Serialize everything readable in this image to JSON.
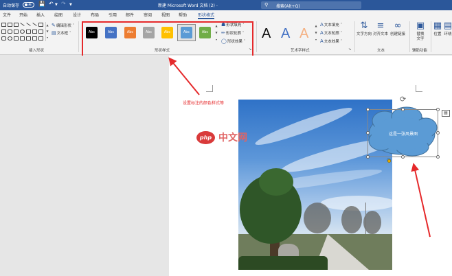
{
  "titlebar": {
    "autosave_label": "自动保存",
    "autosave_state": "关",
    "doc_title": "新建 Microsoft Word 文档 (2)  -",
    "search_placeholder": "搜索(Alt+Q)"
  },
  "tabs": [
    "文件",
    "开始",
    "插入",
    "绘图",
    "设计",
    "布局",
    "引用",
    "邮件",
    "审阅",
    "视图",
    "帮助",
    "形状格式"
  ],
  "active_tab": "形状格式",
  "ribbon": {
    "insert_shapes": {
      "label": "插入形状",
      "edit_shape": "编辑形状",
      "text_box": "文本框"
    },
    "shape_styles": {
      "label": "形状样式",
      "swatch_text": "Abc",
      "swatch_colors": [
        "#000000",
        "#4472c4",
        "#ed7d31",
        "#a5a5a5",
        "#ffc000",
        "#5b9bd5",
        "#70ad47"
      ],
      "selected_index": 5,
      "fill": "形状填充",
      "outline": "形状轮廓",
      "effects": "形状效果"
    },
    "wordart_styles": {
      "label": "艺术字样式",
      "letter": "A",
      "letter_colors": [
        "#111111",
        "#4472c4",
        "#f4b183"
      ],
      "text_fill": "文本填充",
      "text_outline": "文本轮廓",
      "text_effects": "文本效果"
    },
    "text_group": {
      "label": "文本",
      "text_direction": "文字方向",
      "align_text": "对齐文本",
      "create_link": "创建链接"
    },
    "accessibility": {
      "label": "辅助功能",
      "alt_text": "替换\n文字"
    },
    "arrange": {
      "position": "位置",
      "wrap": "环绕"
    }
  },
  "annotation": {
    "text": "设置标注的颜色样式等",
    "color": "#e5292b"
  },
  "watermark": {
    "logo": "php",
    "text": "中文网"
  },
  "shape": {
    "text": "这是一张风景图",
    "fill_color": "#5b9bd5"
  },
  "colors": {
    "brand": "#2b579a",
    "highlight_red": "#e5292b"
  },
  "icons": {
    "search": "search-icon",
    "undo": "undo-icon",
    "redo": "redo-icon",
    "save": "save-icon",
    "rotate": "rotate-handle-icon",
    "layout": "layout-options-icon"
  }
}
